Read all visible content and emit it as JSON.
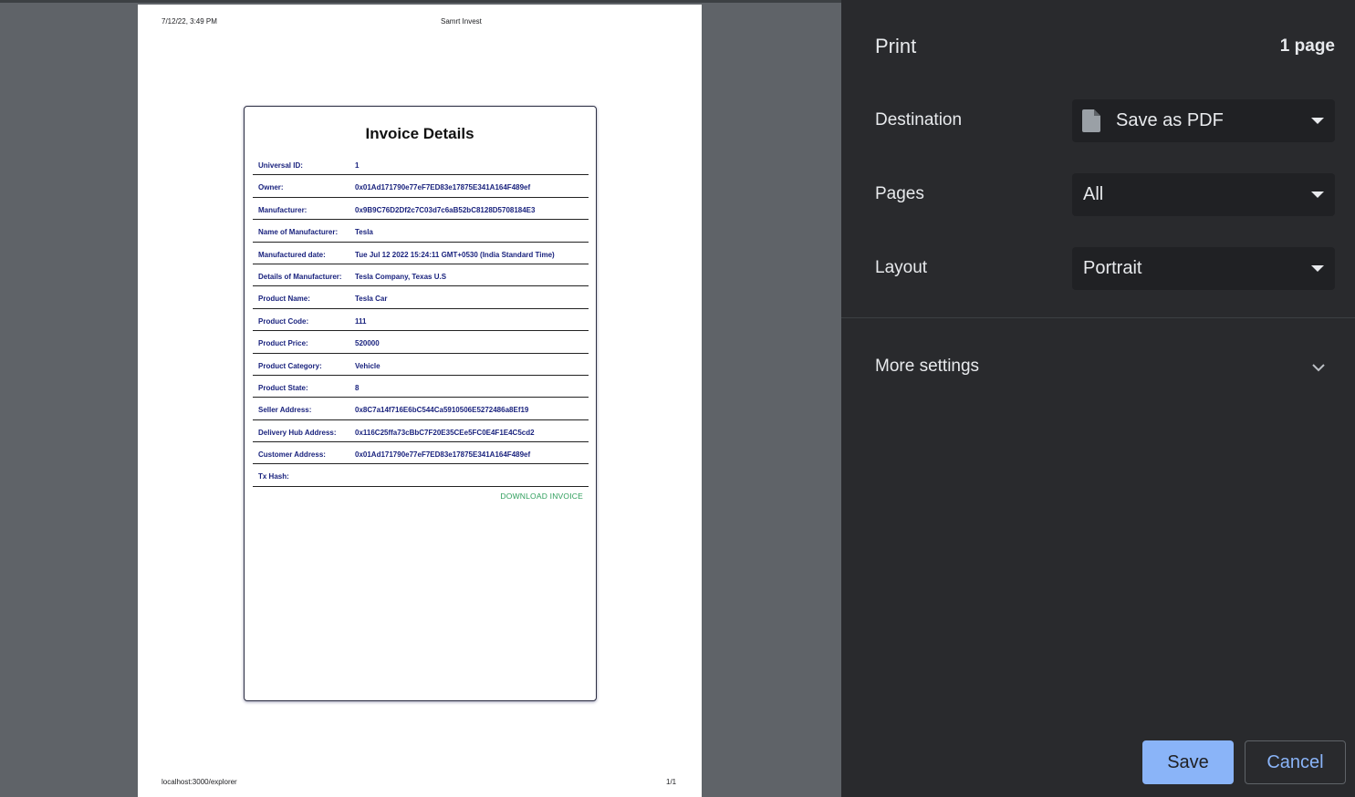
{
  "preview": {
    "header_date": "7/12/22, 3:49 PM",
    "header_title": "Samrt Invest",
    "footer_url": "localhost:3000/explorer",
    "footer_page": "1/1",
    "invoice": {
      "title": "Invoice Details",
      "rows": [
        {
          "label": "Universal ID:",
          "value": "1"
        },
        {
          "label": "Owner:",
          "value": "0x01Ad171790e77eF7ED83e17875E341A164F489ef"
        },
        {
          "label": "Manufacturer:",
          "value": "0x9B9C76D2Df2c7C03d7c6aB52bC8128D5708184E3"
        },
        {
          "label": "Name of Manufacturer:",
          "value": "Tesla"
        },
        {
          "label": "Manufactured date:",
          "value": "Tue Jul 12 2022 15:24:11 GMT+0530 (India Standard Time)"
        },
        {
          "label": "Details of Manufacturer:",
          "value": "Tesla Company, Texas U.S"
        },
        {
          "label": "Product Name:",
          "value": "Tesla Car"
        },
        {
          "label": "Product Code:",
          "value": "111"
        },
        {
          "label": "Product Price:",
          "value": "520000"
        },
        {
          "label": "Product Category:",
          "value": "Vehicle"
        },
        {
          "label": "Product State:",
          "value": "8"
        },
        {
          "label": "Seller Address:",
          "value": "0x8C7a14f716E6bC544Ca5910506E5272486a8Ef19"
        },
        {
          "label": "Delivery Hub Address:",
          "value": "0x116C25ffa73cBbC7F20E35CEe5FC0E4F1E4C5cd2"
        },
        {
          "label": "Customer Address:",
          "value": "0x01Ad171790e77eF7ED83e17875E341A164F489ef"
        },
        {
          "label": "Tx Hash:",
          "value": ""
        }
      ],
      "download_label": "DOWNLOAD INVOICE"
    }
  },
  "panel": {
    "title": "Print",
    "page_count": "1 page",
    "destination": {
      "label": "Destination",
      "value": "Save as PDF",
      "icon": "file-icon"
    },
    "pages": {
      "label": "Pages",
      "value": "All"
    },
    "layout": {
      "label": "Layout",
      "value": "Portrait"
    },
    "more_settings": "More settings",
    "save_label": "Save",
    "cancel_label": "Cancel"
  },
  "colors": {
    "panel_bg": "#292a2d",
    "select_bg": "#202124",
    "accent": "#8ab4f8",
    "preview_bg": "#5f6368",
    "invoice_text": "#1a237e",
    "download_green": "#2e9e5b"
  }
}
